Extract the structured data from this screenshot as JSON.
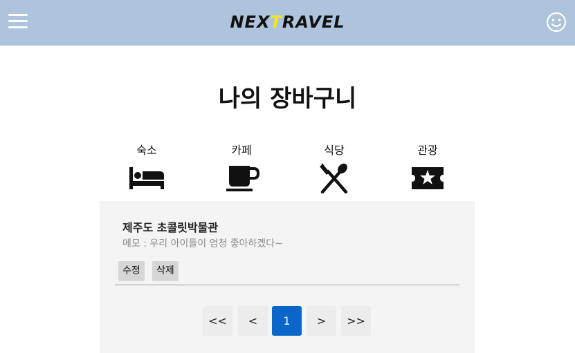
{
  "header": {
    "logo_parts": [
      "NEX",
      "T",
      "RAVEL"
    ],
    "accent_color": "#f2e51a",
    "bar_color": "#aec4dd",
    "menu_icon": "hamburger-menu-icon",
    "profile_icon": "smiley-face-icon"
  },
  "page": {
    "title": "나의 장바구니"
  },
  "categories": [
    {
      "label": "숙소",
      "icon": "bed-icon"
    },
    {
      "label": "카페",
      "icon": "coffee-cup-icon"
    },
    {
      "label": "식당",
      "icon": "utensils-icon"
    },
    {
      "label": "관광",
      "icon": "ticket-star-icon"
    }
  ],
  "cart_item": {
    "name": "제주도 초콜릿박물관",
    "memo": "메모 : 우리 아이들이 엄청 좋아하겠다~",
    "edit_label": "수정",
    "delete_label": "삭제"
  },
  "pagination": {
    "first": "<<",
    "prev": "<",
    "current": "1",
    "next": ">",
    "last": ">>",
    "active_color": "#0a66c8"
  }
}
